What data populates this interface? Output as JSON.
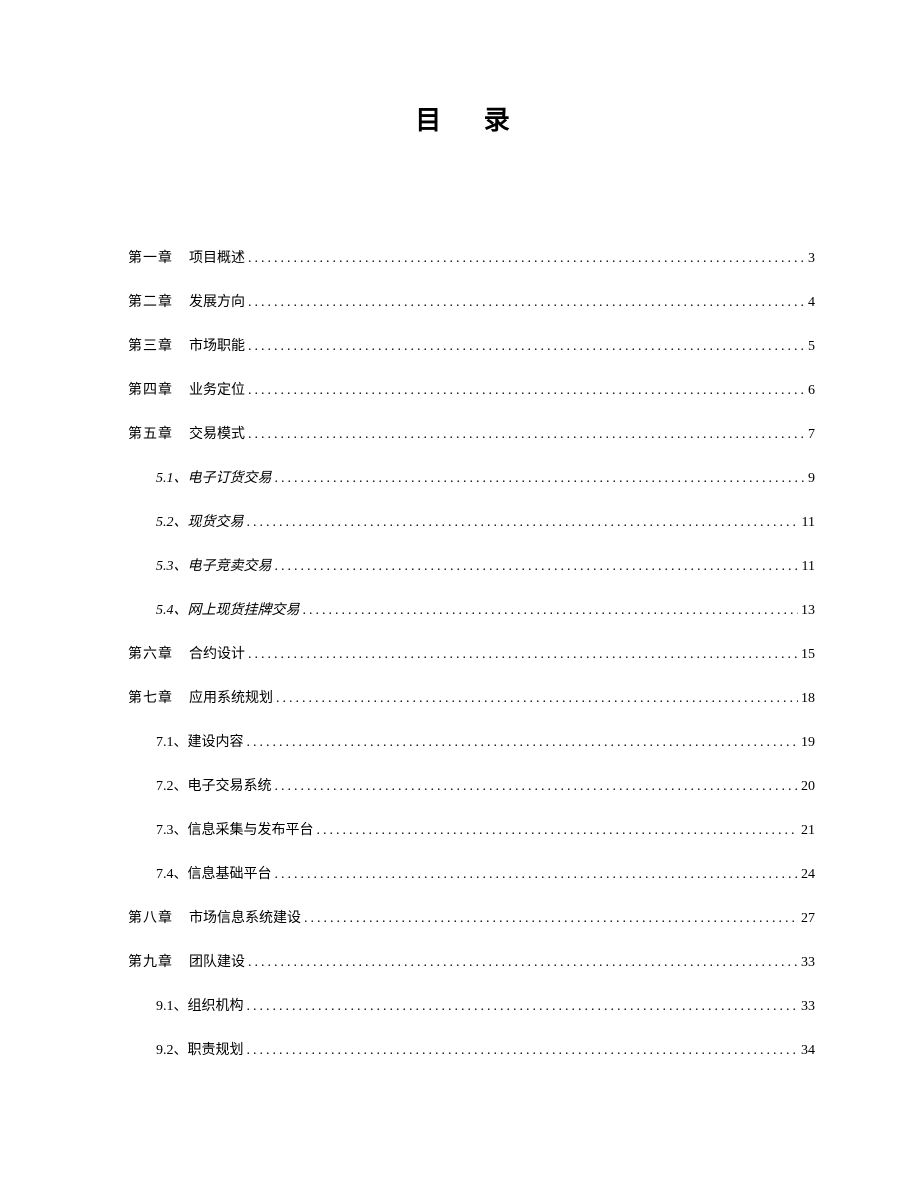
{
  "title": "目 录",
  "entries": [
    {
      "level": 1,
      "italic": false,
      "label": "第一章",
      "title": "项目概述",
      "page": "3"
    },
    {
      "level": 1,
      "italic": false,
      "label": "第二章",
      "title": "发展方向",
      "page": "4"
    },
    {
      "level": 1,
      "italic": false,
      "label": "第三章",
      "title": "市场职能",
      "page": "5"
    },
    {
      "level": 1,
      "italic": false,
      "label": "第四章",
      "title": "业务定位",
      "page": "6"
    },
    {
      "level": 1,
      "italic": false,
      "label": "第五章",
      "title": "交易模式",
      "page": "7"
    },
    {
      "level": 2,
      "italic": true,
      "label": "5.1、",
      "title": "电子订货交易",
      "page": "9"
    },
    {
      "level": 2,
      "italic": true,
      "label": "5.2、",
      "title": "现货交易",
      "page": "11"
    },
    {
      "level": 2,
      "italic": true,
      "label": "5.3、",
      "title": "电子竞卖交易",
      "page": "11"
    },
    {
      "level": 2,
      "italic": true,
      "label": "5.4、",
      "title": "网上现货挂牌交易",
      "page": "13"
    },
    {
      "level": 1,
      "italic": false,
      "label": "第六章",
      "title": "合约设计",
      "page": "15"
    },
    {
      "level": 1,
      "italic": false,
      "label": "第七章",
      "title": "应用系统规划",
      "page": "18"
    },
    {
      "level": 2,
      "italic": false,
      "label": "7.1、",
      "title": "建设内容",
      "page": "19"
    },
    {
      "level": 2,
      "italic": false,
      "label": "7.2、",
      "title": "电子交易系统",
      "page": "20"
    },
    {
      "level": 2,
      "italic": false,
      "label": "7.3、",
      "title": "信息采集与发布平台",
      "page": "21"
    },
    {
      "level": 2,
      "italic": false,
      "label": "7.4、",
      "title": "信息基础平台",
      "page": "24"
    },
    {
      "level": 1,
      "italic": false,
      "label": "第八章",
      "title": "市场信息系统建设",
      "page": "27"
    },
    {
      "level": 1,
      "italic": false,
      "label": "第九章",
      "title": "团队建设",
      "page": "33"
    },
    {
      "level": 2,
      "italic": false,
      "label": "9.1、",
      "title": "组织机构",
      "page": "33"
    },
    {
      "level": 2,
      "italic": false,
      "label": "9.2、",
      "title": "职责规划",
      "page": "34"
    }
  ]
}
